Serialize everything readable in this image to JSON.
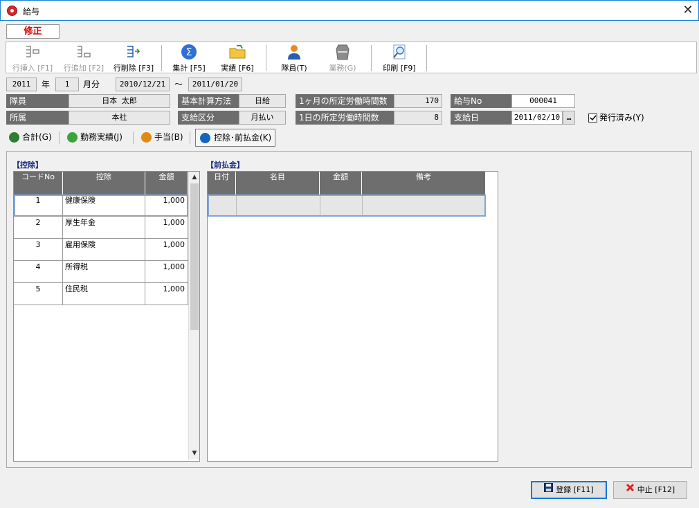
{
  "window": {
    "title": "給与",
    "close_glyph": "✕"
  },
  "mode_badge": "修正",
  "toolbar": {
    "insert_row": "行挿入 [F1]",
    "add_row": "行追加 [F2]",
    "delete_row": "行削除 [F3]",
    "aggregate": "集計 [F5]",
    "actuals": "実績 [F6]",
    "member": "隊員(T)",
    "business": "業務(G)",
    "print": "印刷 [F9]"
  },
  "period": {
    "year": "2011",
    "year_unit": "年",
    "month": "1",
    "month_unit": "月分",
    "from": "2010/12/21",
    "tilde": "～",
    "to": "2011/01/20"
  },
  "fields": {
    "member_label": "隊員",
    "member_value": "日本 太郎",
    "dept_label": "所属",
    "dept_value": "本社",
    "calc_method_label": "基本計算方法",
    "calc_method_value": "日給",
    "pay_type_label": "支給区分",
    "pay_type_value": "月払い",
    "monthly_hours_label": "1ヶ月の所定労働時間数",
    "monthly_hours_value": "170",
    "daily_hours_label": "1日の所定労働時間数",
    "daily_hours_value": "8",
    "salary_no_label": "給与No",
    "salary_no_value": "000041",
    "pay_date_label": "支給日",
    "pay_date_value": "2011/02/10",
    "pay_date_button": "…",
    "issued_label": "発行済み(Y)",
    "issued_checked": true
  },
  "tabs": [
    {
      "label": "合計(G)",
      "color": "#2e7d32"
    },
    {
      "label": "勤務実績(J)",
      "color": "#3aa53a"
    },
    {
      "label": "手当(B)",
      "color": "#e08a12"
    },
    {
      "label": "控除･前払金(K)",
      "color": "#1565c0"
    }
  ],
  "deduction": {
    "title": "【控除】",
    "headers": [
      "コードNo",
      "控除",
      "金額"
    ],
    "rows": [
      {
        "code": "1",
        "name": "健康保険",
        "amount": "1,000"
      },
      {
        "code": "2",
        "name": "厚生年金",
        "amount": "1,000"
      },
      {
        "code": "3",
        "name": "雇用保険",
        "amount": "1,000"
      },
      {
        "code": "4",
        "name": "所得税",
        "amount": "1,000"
      },
      {
        "code": "5",
        "name": "住民税",
        "amount": "1,000"
      }
    ]
  },
  "advance": {
    "title": "【前払金】",
    "headers": [
      "日付",
      "名目",
      "金額",
      "備考"
    ]
  },
  "buttons": {
    "register": "登録 [F11]",
    "cancel": "中止 [F12]"
  }
}
